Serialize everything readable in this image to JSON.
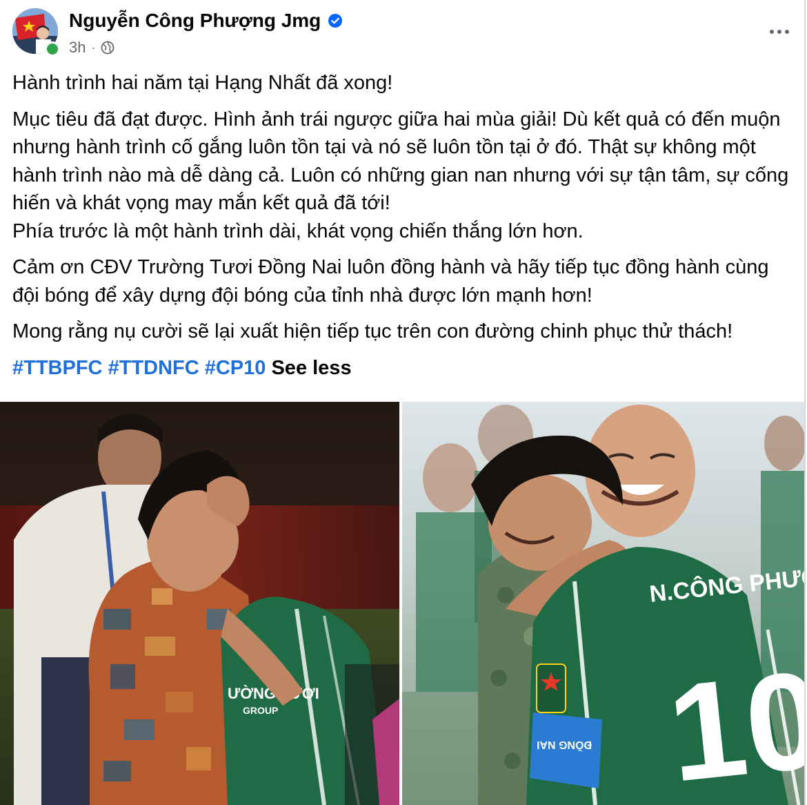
{
  "post": {
    "author": {
      "name": "Nguyễn Công Phượng Jmg",
      "verified": true
    },
    "time": "3h",
    "meta_separator": "·",
    "paragraphs": [
      "Hành trình hai năm tại Hạng Nhất đã xong!",
      "Mục tiêu đã đạt được. Hình ảnh trái ngược giữa hai mùa giải! Dù kết quả có đến muộn nhưng hành trình cố gắng luôn tồn tại và nó sẽ luôn tồn tại ở đó. Thật sự không một hành trình nào mà dễ dàng cả. Luôn có những gian nan nhưng với sự tận tâm, sự cống hiến và khát vọng may mắn kết quả đã tới!",
      "Phía trước là một hành trình dài, khát vọng chiến thắng lớn hơn.",
      "Cảm ơn CĐV Trường Tươi Đồng Nai luôn đồng hành và hãy tiếp tục đồng hành cùng đội bóng để xây dựng đội bóng của tỉnh nhà được lớn mạnh hơn!",
      "Mong rằng nụ cười sẽ lại xuất hiện tiếp tục trên con đường chinh phục thử thách!"
    ],
    "hashtags": [
      "#TTBPFC",
      "#TTDNFC",
      "#CP10"
    ],
    "see_less_label": "See less",
    "photos": {
      "left": {
        "jersey_text": "ƯỜNG TƯƠI",
        "jersey_subtext": "GROUP"
      },
      "right": {
        "jersey_name": "N.CÔNG PHƯỢNG",
        "jersey_number": "10",
        "armband_text": "ĐỒNG NAI"
      }
    }
  },
  "colors": {
    "hashtag": "#216fdb",
    "verified": "#0866ff",
    "online": "#31a24c",
    "meta": "#65676b",
    "jersey_green": "#1f6b45"
  },
  "icons": {
    "verified": "verified-badge-icon",
    "privacy": "globe-icon",
    "more": "more-options-icon"
  }
}
